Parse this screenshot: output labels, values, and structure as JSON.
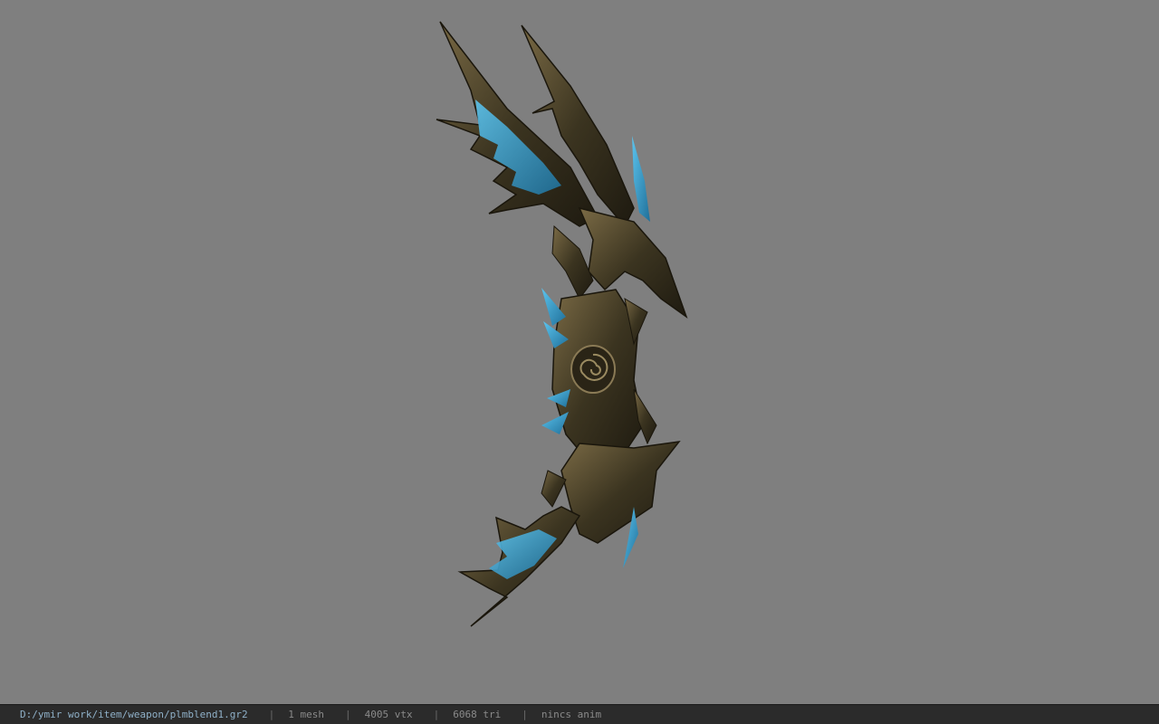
{
  "viewer": {
    "background_color": "#7f7f7f",
    "model": {
      "metal_color": "#3b3420",
      "metal_highlight": "#7a6a45",
      "accent_color": "#3aa0d0"
    }
  },
  "status_bar": {
    "file_path": "D:/ymir work/item/weapon/plmblend1.gr2",
    "separator": "|",
    "mesh_count": "1 mesh",
    "vertex_count": "4005 vtx",
    "triangle_count": "6068 tri",
    "animation": "nincs anim"
  }
}
